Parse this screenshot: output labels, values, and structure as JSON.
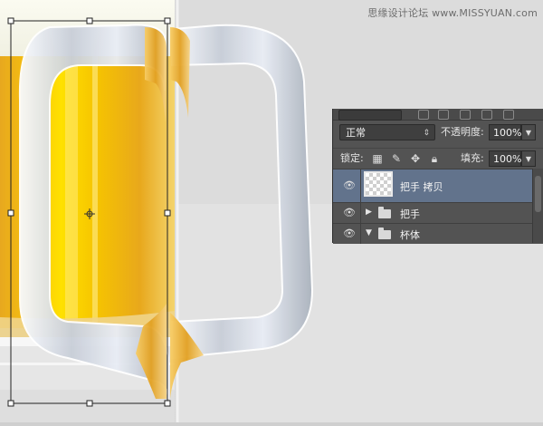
{
  "watermark": "思缘设计论坛  www.MISSYUAN.com",
  "layers_panel": {
    "blend_mode": "正常",
    "opacity_label": "不透明度:",
    "opacity_value": "100%",
    "lock_label": "锁定:",
    "fill_label": "填充:",
    "fill_value": "100%",
    "layers": [
      {
        "name": "把手 拷贝",
        "selected": true,
        "type": "layer"
      },
      {
        "name": "把手",
        "selected": false,
        "type": "group-collapsed"
      },
      {
        "name": "杯体",
        "selected": false,
        "type": "group-expanded"
      }
    ],
    "icons": [
      "eye-icon",
      "folder-icon",
      "lock-icon",
      "move-icon",
      "brush-icon",
      "checker-lock-icon"
    ]
  },
  "colors": {
    "canvas_bg": "#cfcfcf",
    "beer_gold": "#e8a81c",
    "panel_bg": "#535353",
    "selected_row": "#62738c"
  }
}
